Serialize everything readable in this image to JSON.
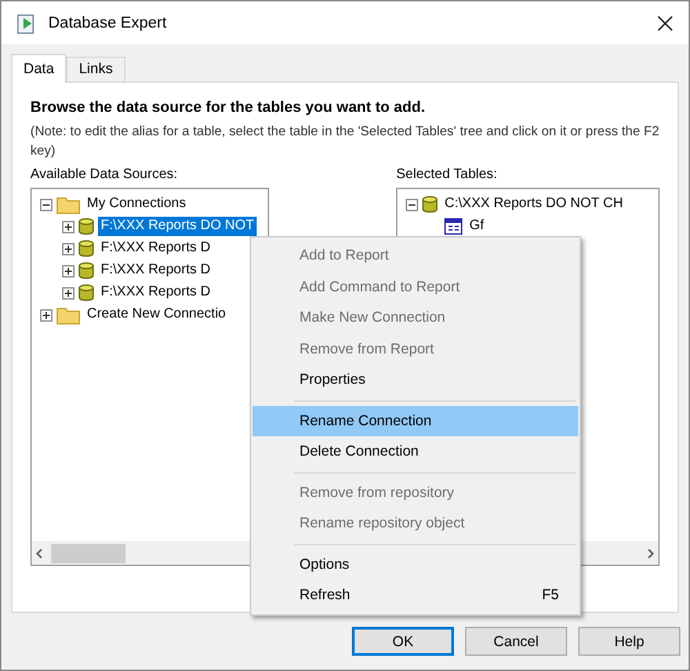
{
  "window": {
    "title": "Database Expert"
  },
  "tabs": [
    {
      "label": "Data",
      "selected": true
    },
    {
      "label": "Links",
      "selected": false
    }
  ],
  "heading": "Browse the data source for the tables you want to add.",
  "note": "(Note: to edit the alias for a table, select the table in the 'Selected Tables' tree and click on it or press the F2 key)",
  "available": {
    "label": "Available Data Sources:",
    "tree": [
      {
        "kind": "folder",
        "label": "My Connections",
        "expanded": true,
        "selected": false,
        "children": [
          {
            "kind": "database",
            "label": "F:\\XXX Reports DO NOT",
            "expanded": false,
            "selected": true
          },
          {
            "kind": "database",
            "label": "F:\\XXX Reports D",
            "expanded": false,
            "selected": false
          },
          {
            "kind": "database",
            "label": "F:\\XXX Reports D",
            "expanded": false,
            "selected": false
          },
          {
            "kind": "database",
            "label": "F:\\XXX Reports D",
            "expanded": false,
            "selected": false
          }
        ]
      },
      {
        "kind": "folder",
        "label": "Create New Connectio",
        "expanded": false,
        "selected": false
      }
    ]
  },
  "selected_tables": {
    "label": "Selected Tables:",
    "tree": [
      {
        "kind": "database",
        "label": "C:\\XXX Reports DO NOT CH",
        "expanded": true,
        "selected": false,
        "children": [
          {
            "kind": "table",
            "label": "Gf",
            "selected": false
          }
        ]
      }
    ]
  },
  "context_menu": [
    {
      "kind": "item",
      "label": "Add to Report",
      "disabled": true,
      "selected": false
    },
    {
      "kind": "item",
      "label": "Add Command to Report",
      "disabled": true,
      "selected": false
    },
    {
      "kind": "item",
      "label": "Make New Connection",
      "disabled": true,
      "selected": false
    },
    {
      "kind": "item",
      "label": "Remove from Report",
      "disabled": true,
      "selected": false
    },
    {
      "kind": "item",
      "label": "Properties",
      "disabled": false,
      "selected": false
    },
    {
      "kind": "separator"
    },
    {
      "kind": "item",
      "label": "Rename Connection",
      "disabled": false,
      "selected": true
    },
    {
      "kind": "item",
      "label": "Delete Connection",
      "disabled": false,
      "selected": false
    },
    {
      "kind": "separator"
    },
    {
      "kind": "item",
      "label": "Remove from repository",
      "disabled": true,
      "selected": false
    },
    {
      "kind": "item",
      "label": "Rename repository object",
      "disabled": true,
      "selected": false
    },
    {
      "kind": "separator"
    },
    {
      "kind": "item",
      "label": "Options",
      "disabled": false,
      "selected": false
    },
    {
      "kind": "item",
      "label": "Refresh",
      "disabled": false,
      "selected": false,
      "shortcut": "F5"
    }
  ],
  "buttons": [
    {
      "label": "OK",
      "default": true
    },
    {
      "label": "Cancel",
      "default": false
    },
    {
      "label": "Help",
      "default": false
    }
  ]
}
